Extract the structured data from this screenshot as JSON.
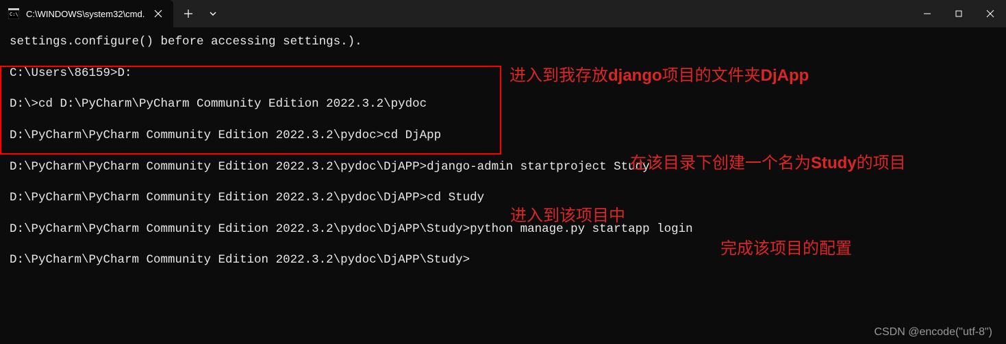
{
  "titlebar": {
    "tab_title": "C:\\WINDOWS\\system32\\cmd."
  },
  "terminal": {
    "line0": "settings.configure() before accessing settings.).",
    "line1": "C:\\Users\\86159>D:",
    "line2": "D:\\>cd D:\\PyCharm\\PyCharm Community Edition 2022.3.2\\pydoc",
    "line3": "D:\\PyCharm\\PyCharm Community Edition 2022.3.2\\pydoc>cd DjApp",
    "line4": "D:\\PyCharm\\PyCharm Community Edition 2022.3.2\\pydoc\\DjAPP>django-admin startproject Study",
    "line5": "D:\\PyCharm\\PyCharm Community Edition 2022.3.2\\pydoc\\DjAPP>cd Study",
    "line6": "D:\\PyCharm\\PyCharm Community Edition 2022.3.2\\pydoc\\DjAPP\\Study>python manage.py startapp login",
    "line7": "D:\\PyCharm\\PyCharm Community Edition 2022.3.2\\pydoc\\DjAPP\\Study>"
  },
  "annotations": {
    "a1_pre": "进入到我存放",
    "a1_bold": "django",
    "a1_mid": "项目的文件夹",
    "a1_bold2": "DjApp",
    "a2_pre": "在该目录下创建一个名为",
    "a2_bold": "Study",
    "a2_post": "的项目",
    "a3": "进入到该项目中",
    "a4": "完成该项目的配置"
  },
  "watermark": "CSDN @encode(\"utf-8\")"
}
